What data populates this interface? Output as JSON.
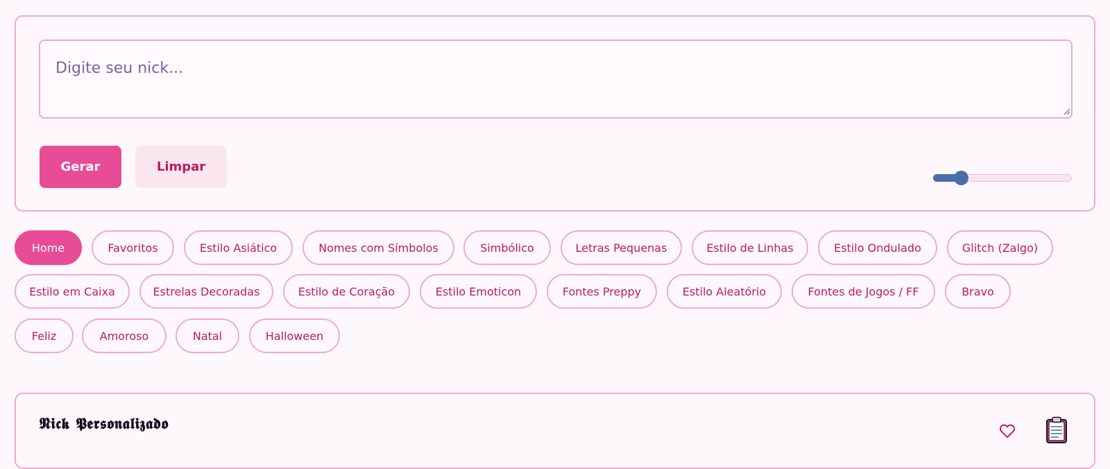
{
  "input": {
    "placeholder": "Digite seu nick...",
    "value": ""
  },
  "buttons": {
    "generate_label": "Gerar",
    "clear_label": "Limpar"
  },
  "slider": {
    "value_fraction": 0.2
  },
  "tabs": [
    {
      "label": "Home",
      "active": true
    },
    {
      "label": "Favoritos",
      "active": false
    },
    {
      "label": "Estilo Asiático",
      "active": false
    },
    {
      "label": "Nomes com Símbolos",
      "active": false
    },
    {
      "label": "Simbólico",
      "active": false
    },
    {
      "label": "Letras Pequenas",
      "active": false
    },
    {
      "label": "Estilo de Linhas",
      "active": false
    },
    {
      "label": "Estilo Ondulado",
      "active": false
    },
    {
      "label": "Glitch (Zalgo)",
      "active": false
    },
    {
      "label": "Estilo em Caixa",
      "active": false
    },
    {
      "label": "Estrelas Decoradas",
      "active": false
    },
    {
      "label": "Estilo de Coração",
      "active": false
    },
    {
      "label": "Estilo Emoticon",
      "active": false
    },
    {
      "label": "Fontes Preppy",
      "active": false
    },
    {
      "label": "Estilo Aleatório",
      "active": false
    },
    {
      "label": "Fontes de Jogos / FF",
      "active": false
    },
    {
      "label": "Bravo",
      "active": false
    },
    {
      "label": "Feliz",
      "active": false
    },
    {
      "label": "Amoroso",
      "active": false
    },
    {
      "label": "Natal",
      "active": false
    },
    {
      "label": "Halloween",
      "active": false
    }
  ],
  "result": {
    "text": "𝕹𝖎𝖈𝖐 𝕻𝖊𝖗𝖘𝖔𝖓𝖆𝖑𝖎𝖟𝖆𝖉𝖔",
    "favorite_icon": "heart-outline-icon",
    "copy_icon": "clipboard-icon"
  },
  "colors": {
    "accent": "#e84c97",
    "accent_text": "#c0185f",
    "border": "#f4a8cb",
    "background": "#fef8fc",
    "slider": "#4a6fa8"
  }
}
